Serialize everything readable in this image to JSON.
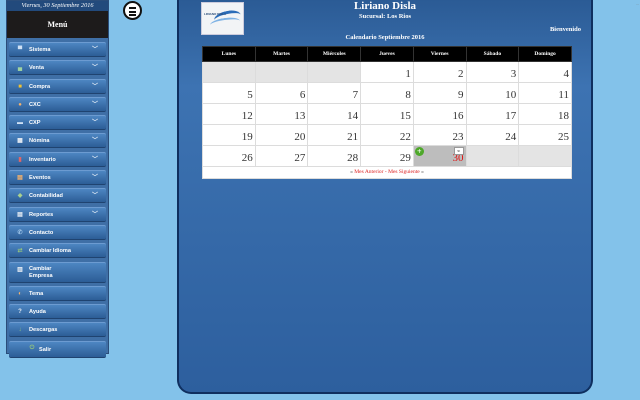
{
  "sidebar": {
    "date": "Viernes, 30 Septiembre 2016",
    "title": "Menú",
    "items": [
      {
        "label": "Sistema",
        "icon": "monitor-icon",
        "dropdown": true
      },
      {
        "label": "Venta",
        "icon": "cart-icon",
        "dropdown": true
      },
      {
        "label": "Compra",
        "icon": "bag-icon",
        "dropdown": true
      },
      {
        "label": "CXC",
        "icon": "people-icon",
        "dropdown": true
      },
      {
        "label": "CXP",
        "icon": "truck-icon",
        "dropdown": true
      },
      {
        "label": "Nómina",
        "icon": "grid-icon",
        "dropdown": true
      },
      {
        "label": "Inventario",
        "icon": "clipboard-icon",
        "dropdown": true
      },
      {
        "label": "Eventos",
        "icon": "calendar-icon",
        "dropdown": true
      },
      {
        "label": "Contabilidad",
        "icon": "coins-icon",
        "dropdown": true
      },
      {
        "label": "Reportes",
        "icon": "report-icon",
        "dropdown": true
      },
      {
        "label": "Contacto",
        "icon": "contact-icon",
        "dropdown": false
      },
      {
        "label": "Cambiar Idioma",
        "icon": "language-icon",
        "dropdown": false
      },
      {
        "label": "Cambiar Empresa",
        "icon": "building-icon",
        "dropdown": false
      },
      {
        "label": "Tema",
        "icon": "theme-icon",
        "dropdown": false
      },
      {
        "label": "Ayuda",
        "icon": "help-icon",
        "dropdown": false
      },
      {
        "label": "Descargas",
        "icon": "download-icon",
        "dropdown": false
      },
      {
        "label": "Salir",
        "icon": "exit-icon",
        "dropdown": false
      }
    ]
  },
  "header": {
    "company": "Liriano Disla",
    "branch": "Sucursal: Los Rios",
    "welcome": "Bienvenido",
    "logo_text": "LIRIANO DISLA"
  },
  "calendar": {
    "title": "Calendario Septiembre 2016",
    "weekdays": [
      "Lunes",
      "Martes",
      "Miércoles",
      "Jueves",
      "Viernes",
      "Sábado",
      "Domingo"
    ],
    "weeks": [
      [
        "",
        "",
        "",
        "1",
        "2",
        "3",
        "4"
      ],
      [
        "5",
        "6",
        "7",
        "8",
        "9",
        "10",
        "11"
      ],
      [
        "12",
        "13",
        "14",
        "15",
        "16",
        "17",
        "18"
      ],
      [
        "19",
        "20",
        "21",
        "22",
        "23",
        "24",
        "25"
      ],
      [
        "26",
        "27",
        "28",
        "29",
        "30",
        "",
        ""
      ]
    ],
    "today": "30",
    "today_icon_label": "30",
    "nav_prefix": "«",
    "prev": "Mes Anterior",
    "separator": "-",
    "next": "Mes Siguiente",
    "nav_suffix": "»"
  },
  "corner_text": "...",
  "colors": {
    "background": "#83c2ea",
    "sidebar": "#3f6fa6",
    "main_panel": "#2d5f9e",
    "header_row": "#000000",
    "today_text": "#e01010",
    "link": "#dd2222"
  }
}
